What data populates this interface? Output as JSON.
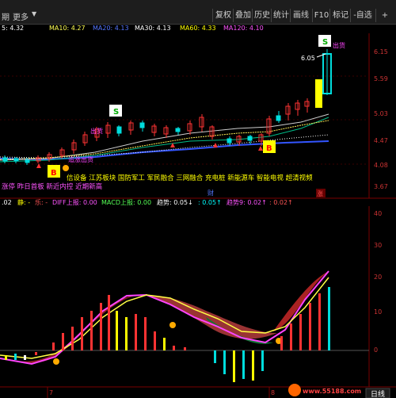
{
  "toolbar": {
    "left_label_1": "期",
    "left_label_2": "更多",
    "buttons": [
      "复权",
      "叠加",
      "历史",
      "统计",
      "画线",
      "F10",
      "标记",
      "-自选",
      "+"
    ]
  },
  "ma_line": [
    {
      "label": "5: 4.32",
      "color": "#ffffff"
    },
    {
      "label": "MA10: 4.27",
      "color": "#ffff55"
    },
    {
      "label": "MA20: 4.13",
      "color": "#5577ff"
    },
    {
      "label": "MA30: 4.13",
      "color": "#ffffff"
    },
    {
      "label": "MA60: 4.33",
      "color": "#ffff00"
    },
    {
      "label": "MA120: 4.10",
      "color": "#ff55ff"
    }
  ],
  "price_axis": [
    "6.15",
    "5.59",
    "5.03",
    "4.47",
    "4.08",
    "3.67"
  ],
  "price_annotations": {
    "high_price": "6.05",
    "s_badge": "S",
    "b_badge": "B",
    "marker_text_1": "出货",
    "marker_text_2": "出货",
    "marker_text_3": "追涨出货"
  },
  "concept_text": "信设备  江苏板块  国防军工  军民融合  三网融合  充电桩  新能源车  智能电视  超清视频",
  "left_banner_text": "涨停 昨日首板  新近内控  近期新高",
  "small_labels": {
    "cai": "财",
    "zhang": "涨"
  },
  "indicator_header": [
    {
      "label": ".02",
      "color": "#ffffff"
    },
    {
      "label": "静: -",
      "color": "#ffff00"
    },
    {
      "label": "乐: -",
      "color": "#ff5555"
    },
    {
      "label": "DIFF上报: 0.00",
      "color": "#ff55ff"
    },
    {
      "label": "MACD上报: 0.00",
      "color": "#55ff55"
    },
    {
      "label": "趋势: 0.05↓",
      "color": "#ffffff"
    },
    {
      "label": ": 0.05↑",
      "color": "#00ffff"
    },
    {
      "label": "趋势9: 0.02↑",
      "color": "#ff55ff"
    },
    {
      "label": ": 0.02↑",
      "color": "#ff5555"
    }
  ],
  "indicator_axis": [
    "40",
    "30",
    "20",
    "10",
    "0"
  ],
  "bottom_axis": {
    "left": "7",
    "mid": "8",
    "tab": "日线"
  },
  "watermark": "www.55188.com",
  "colors": {
    "up": "#ff3333",
    "down": "#00dddd",
    "accent": "#ffff00"
  }
}
